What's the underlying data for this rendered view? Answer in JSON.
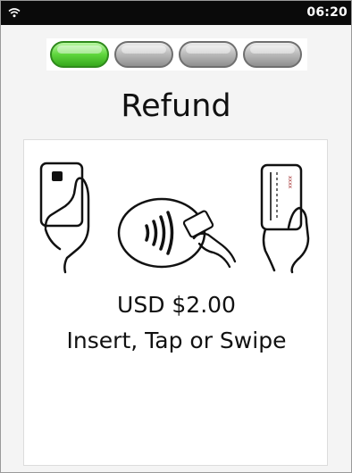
{
  "status_bar": {
    "time": "06:20",
    "wifi_icon": "wifi-icon"
  },
  "progress": {
    "total_steps": 4,
    "current_step": 1,
    "active_color": "#5fd63d",
    "inactive_color": "#bdbdbd"
  },
  "screen": {
    "title": "Refund"
  },
  "payment": {
    "amount": "USD $2.00",
    "instruction": "Insert, Tap or Swipe",
    "icons": [
      "insert-card-icon",
      "contactless-tap-icon",
      "swipe-card-icon"
    ]
  }
}
